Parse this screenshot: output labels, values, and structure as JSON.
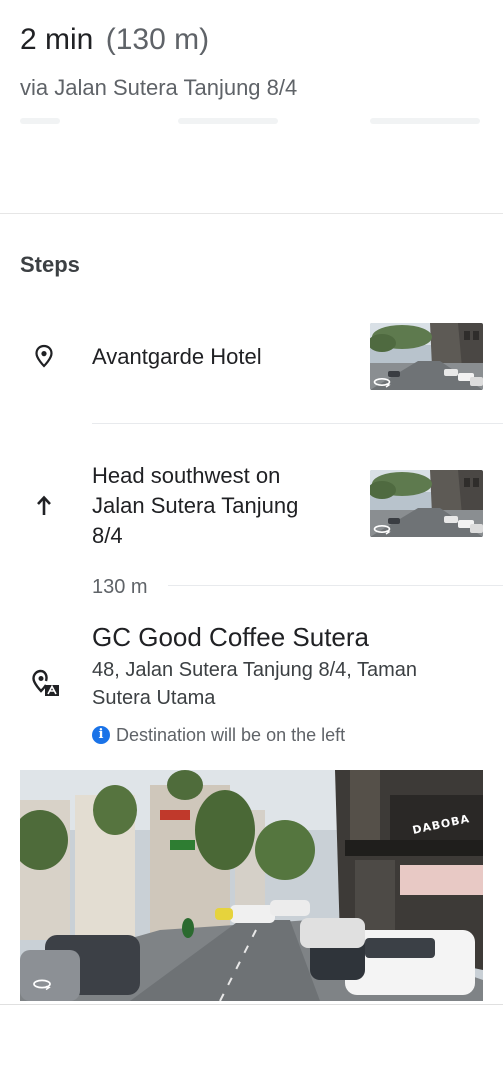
{
  "route": {
    "duration": "2 min",
    "distance": "(130 m)",
    "via": "via Jalan Sutera Tanjung 8/4"
  },
  "steps_section": {
    "title": "Steps"
  },
  "steps": [
    {
      "text": "Avantgarde Hotel",
      "icon": "location-pin-icon"
    },
    {
      "text_lines": [
        "Head southwest on",
        "Jalan Sutera Tanjung",
        "8/4"
      ],
      "icon": "arrow-up-icon",
      "distance": "130 m"
    }
  ],
  "destination": {
    "name": "GC Good Coffee Sutera",
    "address_lines": [
      "48, Jalan Sutera Tanjung 8/4, Taman",
      "Sutera Utama"
    ],
    "note": "Destination will be on the left",
    "icon": "destination-flag-icon",
    "note_icon": "info-icon",
    "signage": "DABOBA"
  },
  "colors": {
    "accent": "#1a73e8",
    "primary_text": "#202124",
    "secondary_text": "#5f6368"
  }
}
